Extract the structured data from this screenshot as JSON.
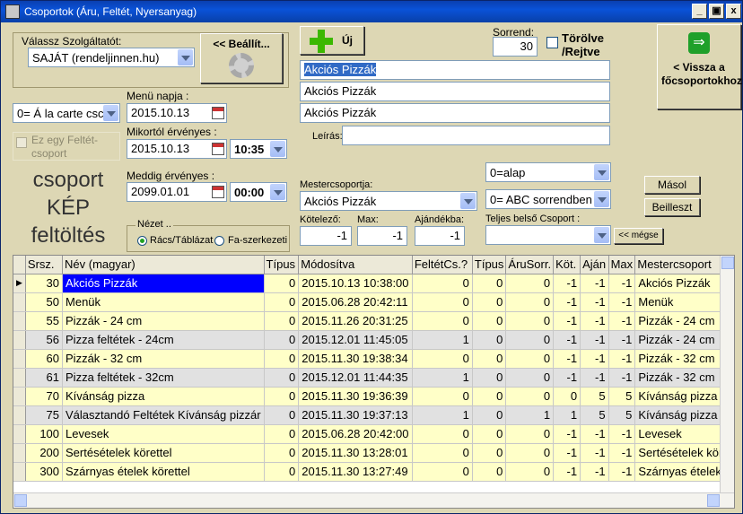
{
  "window": {
    "title": "Csoportok (Áru, Feltét, Nyersanyag)",
    "min": "_",
    "max": "▣",
    "close": "x"
  },
  "form": {
    "provider_label": "Válassz Szolgáltatót:",
    "provider_value": "SAJÁT (rendeljinnen.hu)",
    "settings_btn": "<< Beállít...",
    "new_btn": "Új",
    "sorrend_label": "Sorrend:",
    "sorrend_value": "30",
    "deleted_label": "Törölve /Rejtve",
    "name1": "Akciós Pizzák",
    "name2": "Akciós Pizzák",
    "name3": "Akciós Pizzák",
    "leiras_label": "Leírás:",
    "leiras_value": "",
    "back_btn": "< Vissza a főcsoportokhoz",
    "menu_type_value": "0= Á la carte csc",
    "menu_day_label": "Menü napja :",
    "menu_day_value": "2015.10.13",
    "extra_label": "Ez egy Feltét-csoport",
    "valid_from_label": "Mikortól érvényes :",
    "valid_from_date": "2015.10.13",
    "valid_from_time": "10:35",
    "valid_to_label": "Meddig érvényes :",
    "valid_to_date": "2099.01.01",
    "valid_to_time": "00:00",
    "image_text": "csoport KÉP feltöltés",
    "master_label": "Mestercsoportja:",
    "master_value": "Akciós Pizzák",
    "type_value": "0=alap",
    "order_value": "0= ABC sorrendben",
    "copy_btn": "Másol",
    "paste_btn": "Beilleszt",
    "req_label": "Kötelező:",
    "req_value": "-1",
    "max_label": "Max:",
    "max_value": "-1",
    "gift_label": "Ajándékba:",
    "gift_value": "-1",
    "inner_label": "Teljes belső Csoport :",
    "inner_value": "",
    "cancel_btn": "<< mégse",
    "view_label": "Nézet ..",
    "view_opt1": "Rács/Táblázat",
    "view_opt2": "Fa-szerkezeti"
  },
  "grid": {
    "headers": [
      "Srsz.",
      "Név (magyar)",
      "Típus",
      "Módosítva",
      "FeltétCs.?",
      "Típus",
      "ÁruSorr.",
      "Köt.",
      "Aján",
      "Max",
      "Mestercsoport"
    ],
    "rows": [
      [
        "30",
        "Akciós Pizzák",
        "0",
        "2015.10.13 10:38:00",
        "0",
        "0",
        "0",
        "-1",
        "-1",
        "-1",
        "Akciós Pizzák"
      ],
      [
        "50",
        "Menük",
        "0",
        "2015.06.28 20:42:11",
        "0",
        "0",
        "0",
        "-1",
        "-1",
        "-1",
        "Menük"
      ],
      [
        "55",
        "Pizzák - 24 cm",
        "0",
        "2015.11.26 20:31:25",
        "0",
        "0",
        "0",
        "-1",
        "-1",
        "-1",
        "Pizzák - 24 cm"
      ],
      [
        "56",
        "Pizza feltétek - 24cm",
        "0",
        "2015.12.01 11:45:05",
        "1",
        "0",
        "0",
        "-1",
        "-1",
        "-1",
        "Pizzák - 24 cm"
      ],
      [
        "60",
        "Pizzák - 32 cm",
        "0",
        "2015.11.30 19:38:34",
        "0",
        "0",
        "0",
        "-1",
        "-1",
        "-1",
        "Pizzák - 32 cm"
      ],
      [
        "61",
        "Pizza feltétek - 32cm",
        "0",
        "2015.12.01 11:44:35",
        "1",
        "0",
        "0",
        "-1",
        "-1",
        "-1",
        "Pizzák - 32 cm"
      ],
      [
        "70",
        "Kívánság pizza",
        "0",
        "2015.11.30 19:36:39",
        "0",
        "0",
        "0",
        "0",
        "5",
        "5",
        "Kívánság pizza"
      ],
      [
        "75",
        "Választandó Feltétek Kívánság pizzár",
        "0",
        "2015.11.30 19:37:13",
        "1",
        "0",
        "1",
        "1",
        "5",
        "5",
        "Kívánság pizza"
      ],
      [
        "100",
        "Levesek",
        "0",
        "2015.06.28 20:42:00",
        "0",
        "0",
        "0",
        "-1",
        "-1",
        "-1",
        "Levesek"
      ],
      [
        "200",
        "Sertésételek körettel",
        "0",
        "2015.11.30 13:28:01",
        "0",
        "0",
        "0",
        "-1",
        "-1",
        "-1",
        "Sertésételek köre"
      ],
      [
        "300",
        "Szárnyas ételek körettel",
        "0",
        "2015.11.30 13:27:49",
        "0",
        "0",
        "0",
        "-1",
        "-1",
        "-1",
        "Szárnyas ételek k"
      ]
    ]
  },
  "colors": {
    "title_bar": "#0a46c8",
    "form_bg": "#ddd7b4",
    "row_yellow": "#ffffc8",
    "row_gray": "#e1e1e1",
    "selected": "#0000ff",
    "new_plus": "#3cb800"
  }
}
